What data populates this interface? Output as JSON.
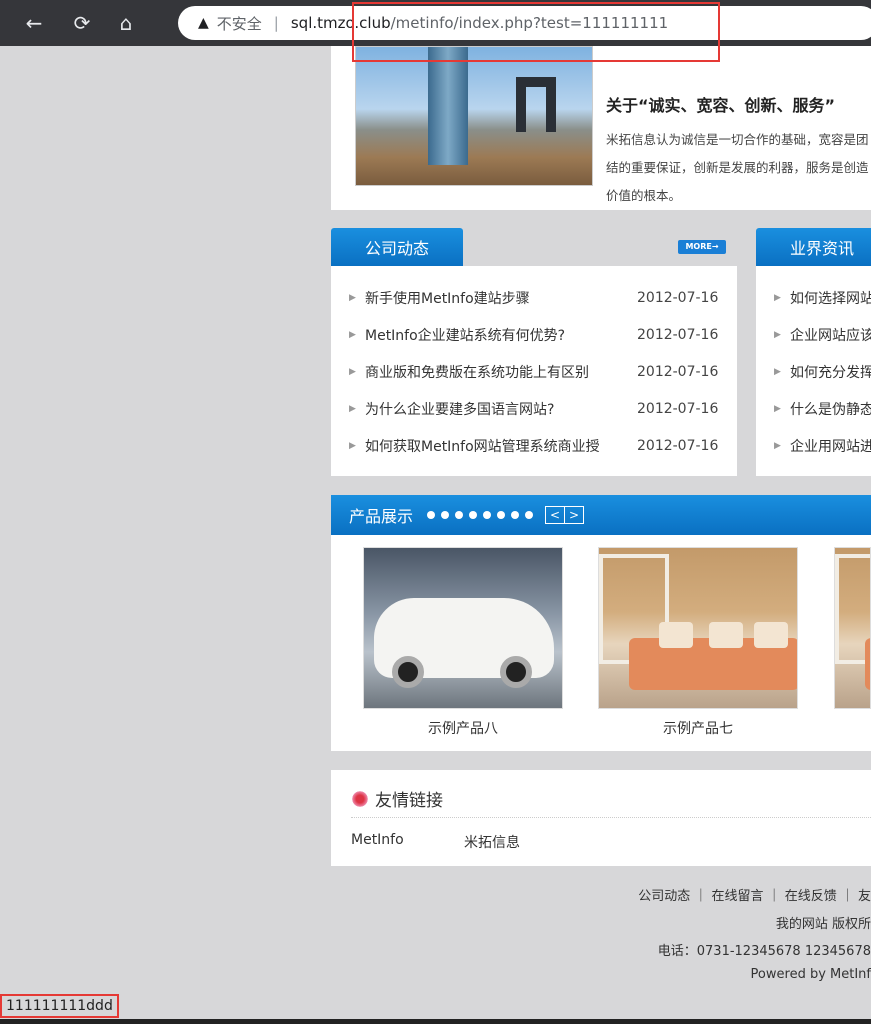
{
  "browser": {
    "security_label": "不安全",
    "separator": "|",
    "url_host": "sql.tmzo.club",
    "url_path": "/metinfo/index.php?test=111111111"
  },
  "about": {
    "title": "关于“诚实、宽容、创新、服务”",
    "text": "米拓信息认为诚信是一切合作的基础，宽容是团结的重要保证，创新是发展的利器，服务是创造价值的根本。"
  },
  "company_news": {
    "tab_label": "公司动态",
    "more_label": "MORE→",
    "items": [
      {
        "title": "新手使用MetInfo建站步骤",
        "date": "2012-07-16"
      },
      {
        "title": "MetInfo企业建站系统有何优势?",
        "date": "2012-07-16"
      },
      {
        "title": "商业版和免费版在系统功能上有区别",
        "date": "2012-07-16"
      },
      {
        "title": "为什么企业要建多国语言网站?",
        "date": "2012-07-16"
      },
      {
        "title": "如何获取MetInfo网站管理系统商业授",
        "date": "2012-07-16"
      }
    ]
  },
  "industry_news": {
    "tab_label": "业界资讯",
    "items": [
      {
        "title": "如何选择网站"
      },
      {
        "title": "企业网站应该"
      },
      {
        "title": "如何充分发挥"
      },
      {
        "title": "什么是伪静态"
      },
      {
        "title": "企业用网站进"
      }
    ]
  },
  "products": {
    "title": "产品展示",
    "prev": "<",
    "next": ">",
    "items": [
      {
        "caption": "示例产品八"
      },
      {
        "caption": "示例产品七"
      }
    ]
  },
  "links": {
    "title": "友情链接",
    "items": [
      "MetInfo",
      "米拓信息"
    ]
  },
  "footer": {
    "nav": "公司动态 ｜ 在线留言 ｜ 在线反馈 ｜ 友",
    "copyright": "我的网站 版权所",
    "phone": "电话：0731-12345678 12345678",
    "powered": "Powered by MetInf"
  },
  "statusbar": {
    "text": "111111111ddd"
  }
}
